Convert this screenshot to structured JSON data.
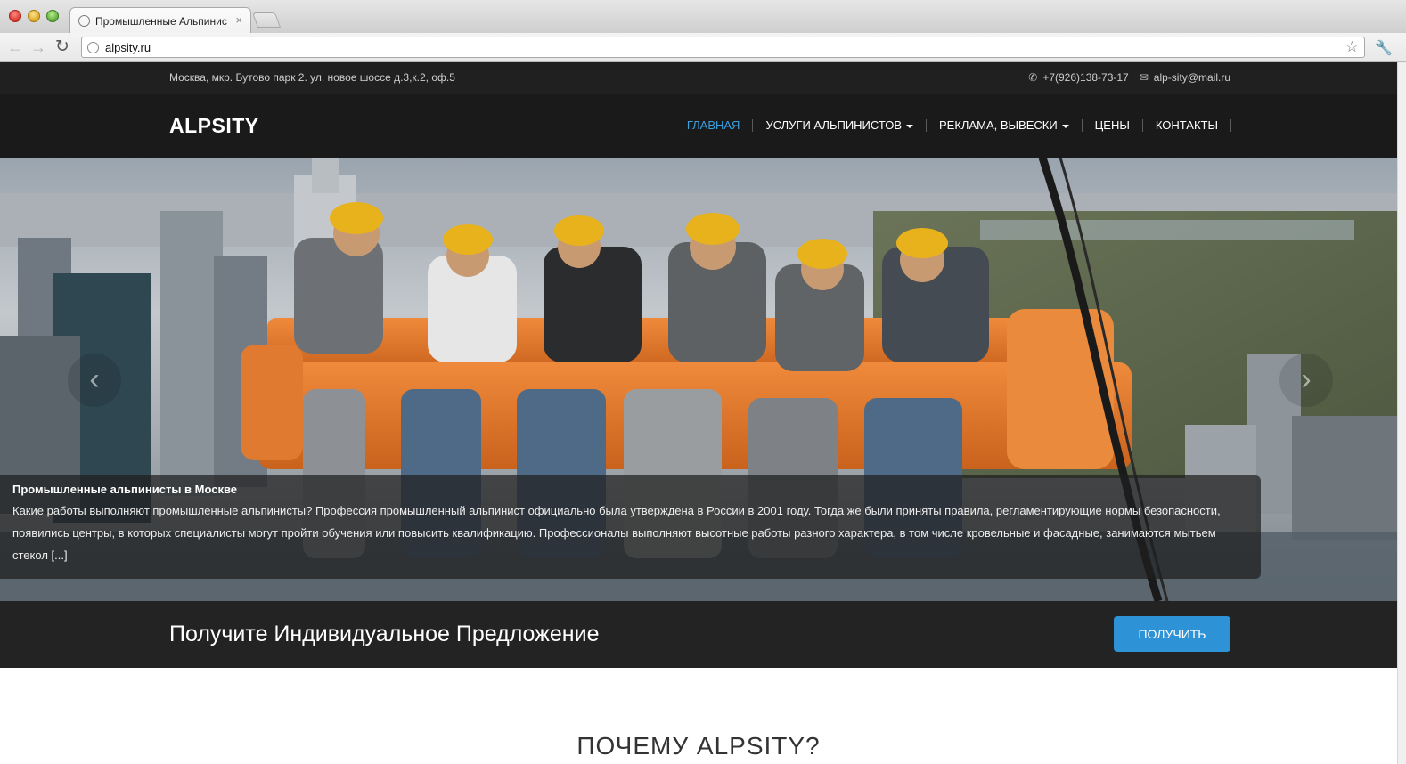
{
  "browser": {
    "tab_title": "Промышленные Альпинист",
    "tab_close": "×",
    "url": "alpsity.ru",
    "icons": [
      "back-icon",
      "forward-icon",
      "reload-icon",
      "globe-icon",
      "star-icon",
      "wrench-icon"
    ]
  },
  "topbar": {
    "address": "Москва, мкр. Бутово парк 2. ул. новое шоссе д.3,к.2, оф.5",
    "phone": "+7(926)138-73-17",
    "email": "alp-sity@mail.ru"
  },
  "header": {
    "logo": "ALPSITY",
    "menu": [
      {
        "label": "ГЛАВНАЯ",
        "active": true
      },
      {
        "label": "УСЛУГИ АЛЬПИНИСТОВ",
        "dropdown": true
      },
      {
        "label": "РЕКЛАМА, ВЫВЕСКИ",
        "dropdown": true
      },
      {
        "label": "ЦЕНЫ"
      },
      {
        "label": "КОНТАКТЫ"
      }
    ],
    "active_color": "#3aa0e0"
  },
  "hero": {
    "prev_arrow": "‹",
    "next_arrow": "›",
    "caption_title": "Промышленные альпинисты в Москве",
    "caption_text": "Какие работы выполняют промышленные альпинисты? Профессия промышленный альпинист официально была утверждена в России в 2001 году. Тогда же были приняты правила, регламентирующие нормы безопасности, появились центры, в которых специалисты могут пройти обучения или повысить квалификацию. Профессионалы выполняют высотные работы разного характера, в том числе кровельные и фасадные, занимаются мытьем стекол [...]"
  },
  "cta": {
    "text": "Получите Индивидуальное Предложение",
    "button": "ПОЛУЧИТЬ",
    "button_color": "#2e93d6"
  },
  "section": {
    "heading": "ПОЧЕМУ ALPSITY?"
  }
}
